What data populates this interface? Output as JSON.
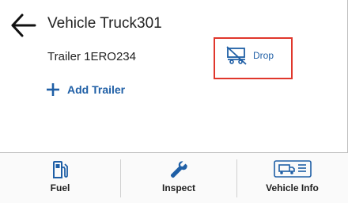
{
  "header": {
    "back_icon": "arrow-left-icon",
    "title": "Vehicle Truck301"
  },
  "trailer": {
    "label": "Trailer 1ERO234",
    "drop_icon": "trailer-off-icon",
    "drop_label": "Drop",
    "highlight_color": "#e0372c"
  },
  "add_trailer": {
    "icon": "plus-icon",
    "label": "Add Trailer"
  },
  "bottom_nav": {
    "tabs": [
      {
        "icon": "fuel-pump-icon",
        "label": "Fuel"
      },
      {
        "icon": "wrench-icon",
        "label": "Inspect"
      },
      {
        "icon": "vehicle-info-icon",
        "label": "Vehicle Info"
      }
    ]
  },
  "colors": {
    "accent": "#1f5fa6",
    "text": "#222222"
  }
}
